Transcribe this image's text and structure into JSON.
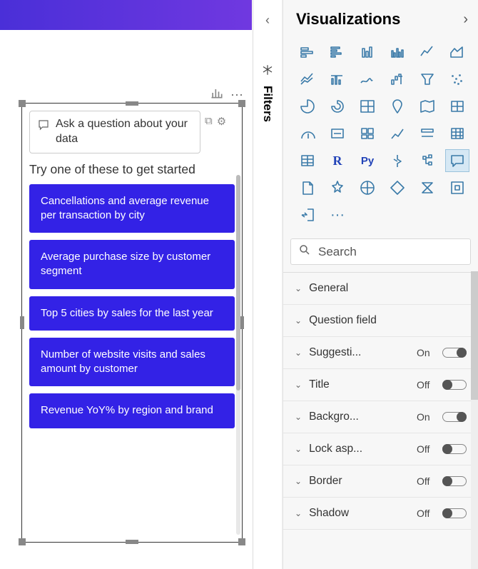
{
  "canvas": {
    "qna": {
      "placeholder": "Ask a question about your data",
      "prompt": "Try one of these to get started",
      "suggestions": [
        "Cancellations and average revenue per transaction by city",
        "Average purchase size by customer segment",
        "Top 5 cities by sales for the last year",
        "Number of website visits and sales amount by customer",
        "Revenue YoY% by region and brand"
      ]
    },
    "toolbar": {
      "convert_icon": "bar-chart-icon",
      "more_icon": "ellipsis-icon"
    }
  },
  "filters_rail": {
    "label": "Filters"
  },
  "visualizations": {
    "title": "Visualizations",
    "icons": [
      "stacked-bar",
      "clustered-bar",
      "stacked-column",
      "clustered-column",
      "line",
      "area",
      "line-stacked",
      "line-clustered",
      "ribbon",
      "waterfall",
      "funnel",
      "scatter",
      "pie",
      "donut",
      "treemap",
      "map",
      "filled-map",
      "shape-map",
      "gauge",
      "card",
      "multi-card",
      "kpi",
      "slicer",
      "table",
      "matrix",
      "r-visual",
      "py-visual",
      "key-influencers",
      "decomposition",
      "qna",
      "paginated",
      "more",
      "arcgis",
      "power-apps",
      "power-automate",
      "custom",
      "get-more",
      "ellipsis"
    ],
    "selected_index": 29,
    "search_placeholder": "Search",
    "format": [
      {
        "label": "General",
        "state": null
      },
      {
        "label": "Question field",
        "state": null
      },
      {
        "label": "Suggesti...",
        "state": "On"
      },
      {
        "label": "Title",
        "state": "Off"
      },
      {
        "label": "Backgro...",
        "state": "On"
      },
      {
        "label": "Lock asp...",
        "state": "Off"
      },
      {
        "label": "Border",
        "state": "Off"
      },
      {
        "label": "Shadow",
        "state": "Off"
      }
    ]
  }
}
